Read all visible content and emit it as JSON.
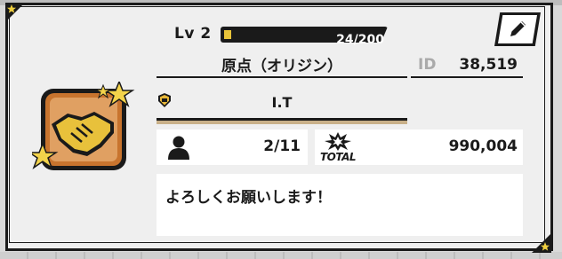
{
  "profile": {
    "level_label": "Lv 2",
    "xp_text": "24/200",
    "xp_progress": 0.12,
    "name": "原点（オリジン）",
    "id_label": "ID",
    "id_value": "38,519",
    "guild_name": "I.T",
    "friends_value": "2/11",
    "total_label": "TOTAL",
    "total_value": "990,004",
    "message": "よろしくお願いします！"
  },
  "colors": {
    "xp_fill": "#e8c43a",
    "guild_accent": "#c9b089",
    "avatar_frame": "#c8742e",
    "handshake": "#e8c13b"
  },
  "icons": {
    "edit": "pencil-icon",
    "guild": "guild-emblem-icon",
    "friends": "person-icon",
    "total": "total-burst-icon",
    "avatar": "handshake-icon"
  }
}
